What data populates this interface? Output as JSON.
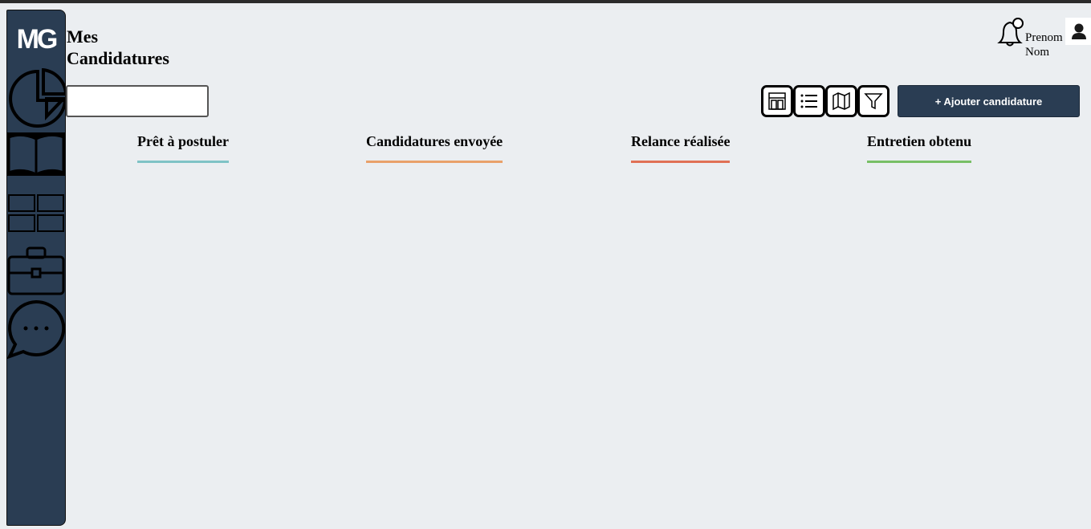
{
  "app": {
    "logo_text": "MG"
  },
  "page": {
    "title_line1": "Mes",
    "title_line2": "Candidatures"
  },
  "user": {
    "first_name": "Prenom",
    "last_name": "Nom"
  },
  "search": {
    "value": "",
    "placeholder": ""
  },
  "toolbar": {
    "view_icons": [
      "kanban-icon",
      "list-icon",
      "map-icon",
      "filter-icon"
    ],
    "add_label": "+ Ajouter candidature"
  },
  "columns": [
    {
      "label": "Prêt à postuler",
      "color": "#7fc3c6"
    },
    {
      "label": "Candidatures envoyée",
      "color": "#e9a16a"
    },
    {
      "label": "Relance réalisée",
      "color": "#e07055"
    },
    {
      "label": "Entretien obtenu",
      "color": "#78bf66"
    }
  ],
  "colors": {
    "sidebar": "#2a3d53",
    "background": "#ebeef1",
    "accent_button": "#2a3d53"
  }
}
